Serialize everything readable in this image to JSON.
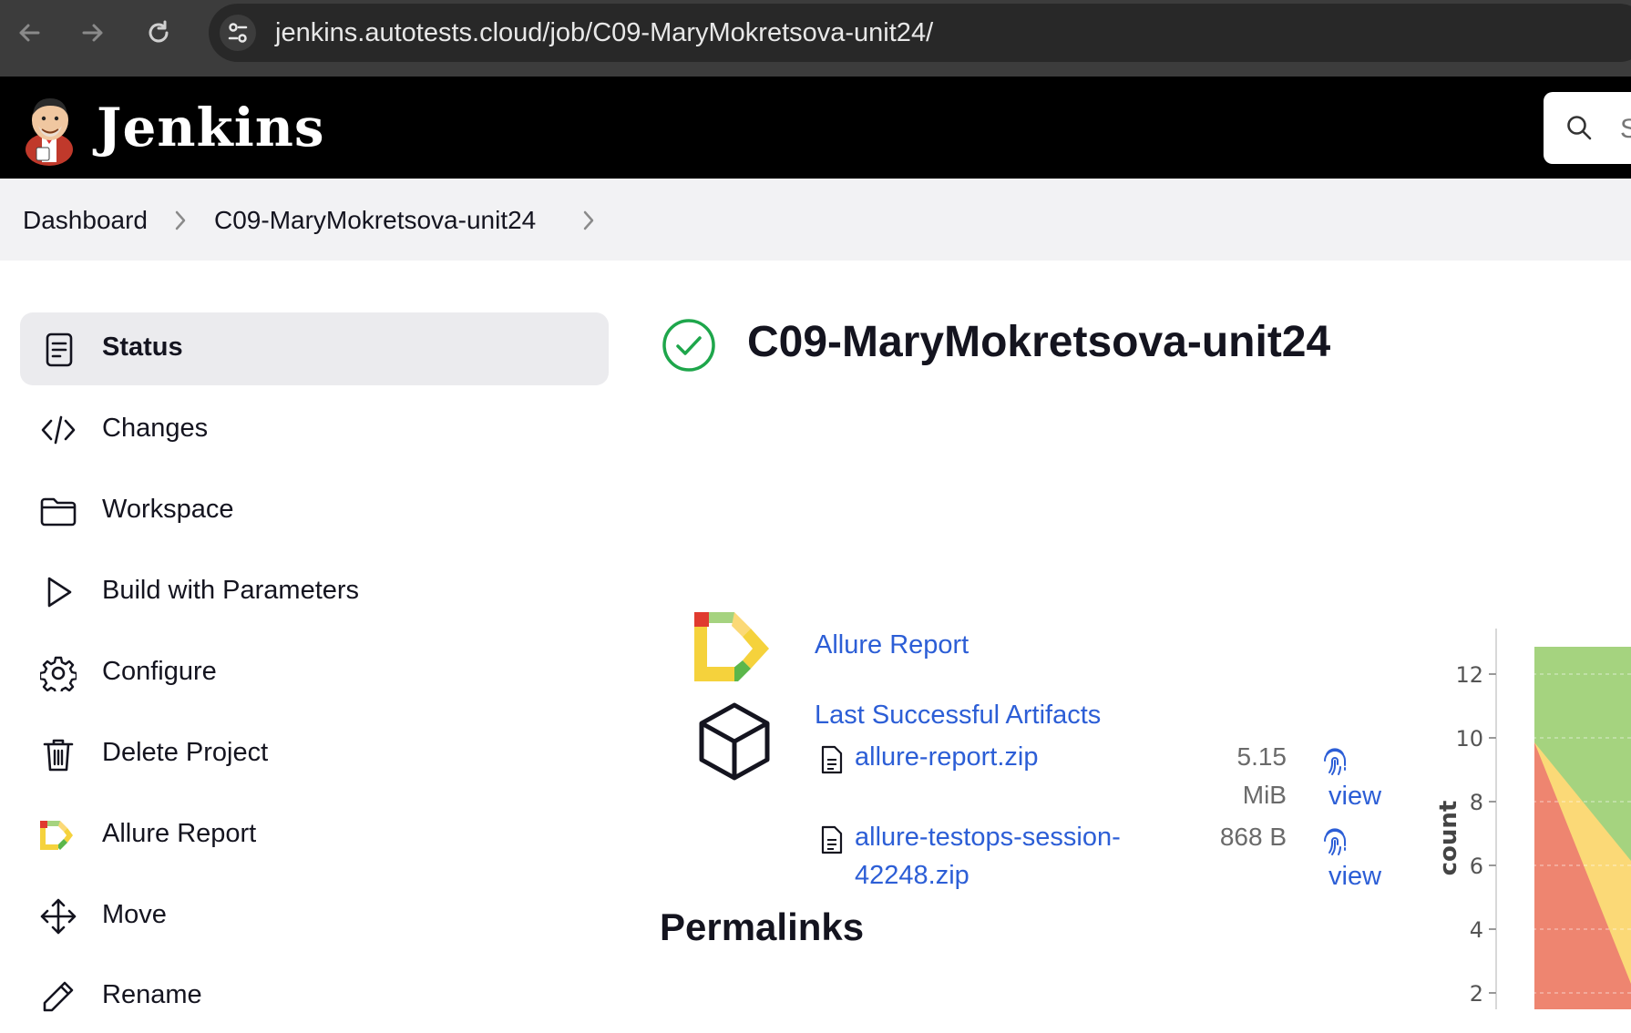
{
  "browser": {
    "url": "jenkins.autotests.cloud/job/C09-MaryMokretsova-unit24/"
  },
  "header": {
    "app_name": "Jenkins",
    "search_placeholder": "S"
  },
  "breadcrumb": {
    "items": [
      "Dashboard",
      "C09-MaryMokretsova-unit24"
    ]
  },
  "sidebar": {
    "items": [
      {
        "label": "Status",
        "icon": "notepad-icon",
        "active": true
      },
      {
        "label": "Changes",
        "icon": "code-icon"
      },
      {
        "label": "Workspace",
        "icon": "folder-icon"
      },
      {
        "label": "Build with Parameters",
        "icon": "play-icon"
      },
      {
        "label": "Configure",
        "icon": "gear-icon"
      },
      {
        "label": "Delete Project",
        "icon": "trash-icon"
      },
      {
        "label": "Allure Report",
        "icon": "allure-icon"
      },
      {
        "label": "Move",
        "icon": "move-icon"
      },
      {
        "label": "Rename",
        "icon": "pencil-icon"
      }
    ]
  },
  "main": {
    "job_title": "C09-MaryMokretsova-unit24",
    "status": "success",
    "allure_link": "Allure Report",
    "artifacts_title": "Last Successful Artifacts",
    "artifacts": [
      {
        "name_line1": "allure-report.zip",
        "name_line2": "",
        "size_line1": "5.15",
        "size_line2": "MiB",
        "view": "view"
      },
      {
        "name_line1": "allure-testops-session-",
        "name_line2": "42248.zip",
        "size_line1": "868 B",
        "size_line2": "",
        "view": "view"
      }
    ],
    "permalinks_heading": "Permalinks"
  },
  "chart_data": {
    "type": "area",
    "ylabel": "count",
    "yticks": [
      "2",
      "4",
      "6",
      "8",
      "10",
      "12"
    ],
    "colors": {
      "passed": "#a5d37f",
      "broken": "#fbd977",
      "failed": "#ee8570"
    }
  }
}
